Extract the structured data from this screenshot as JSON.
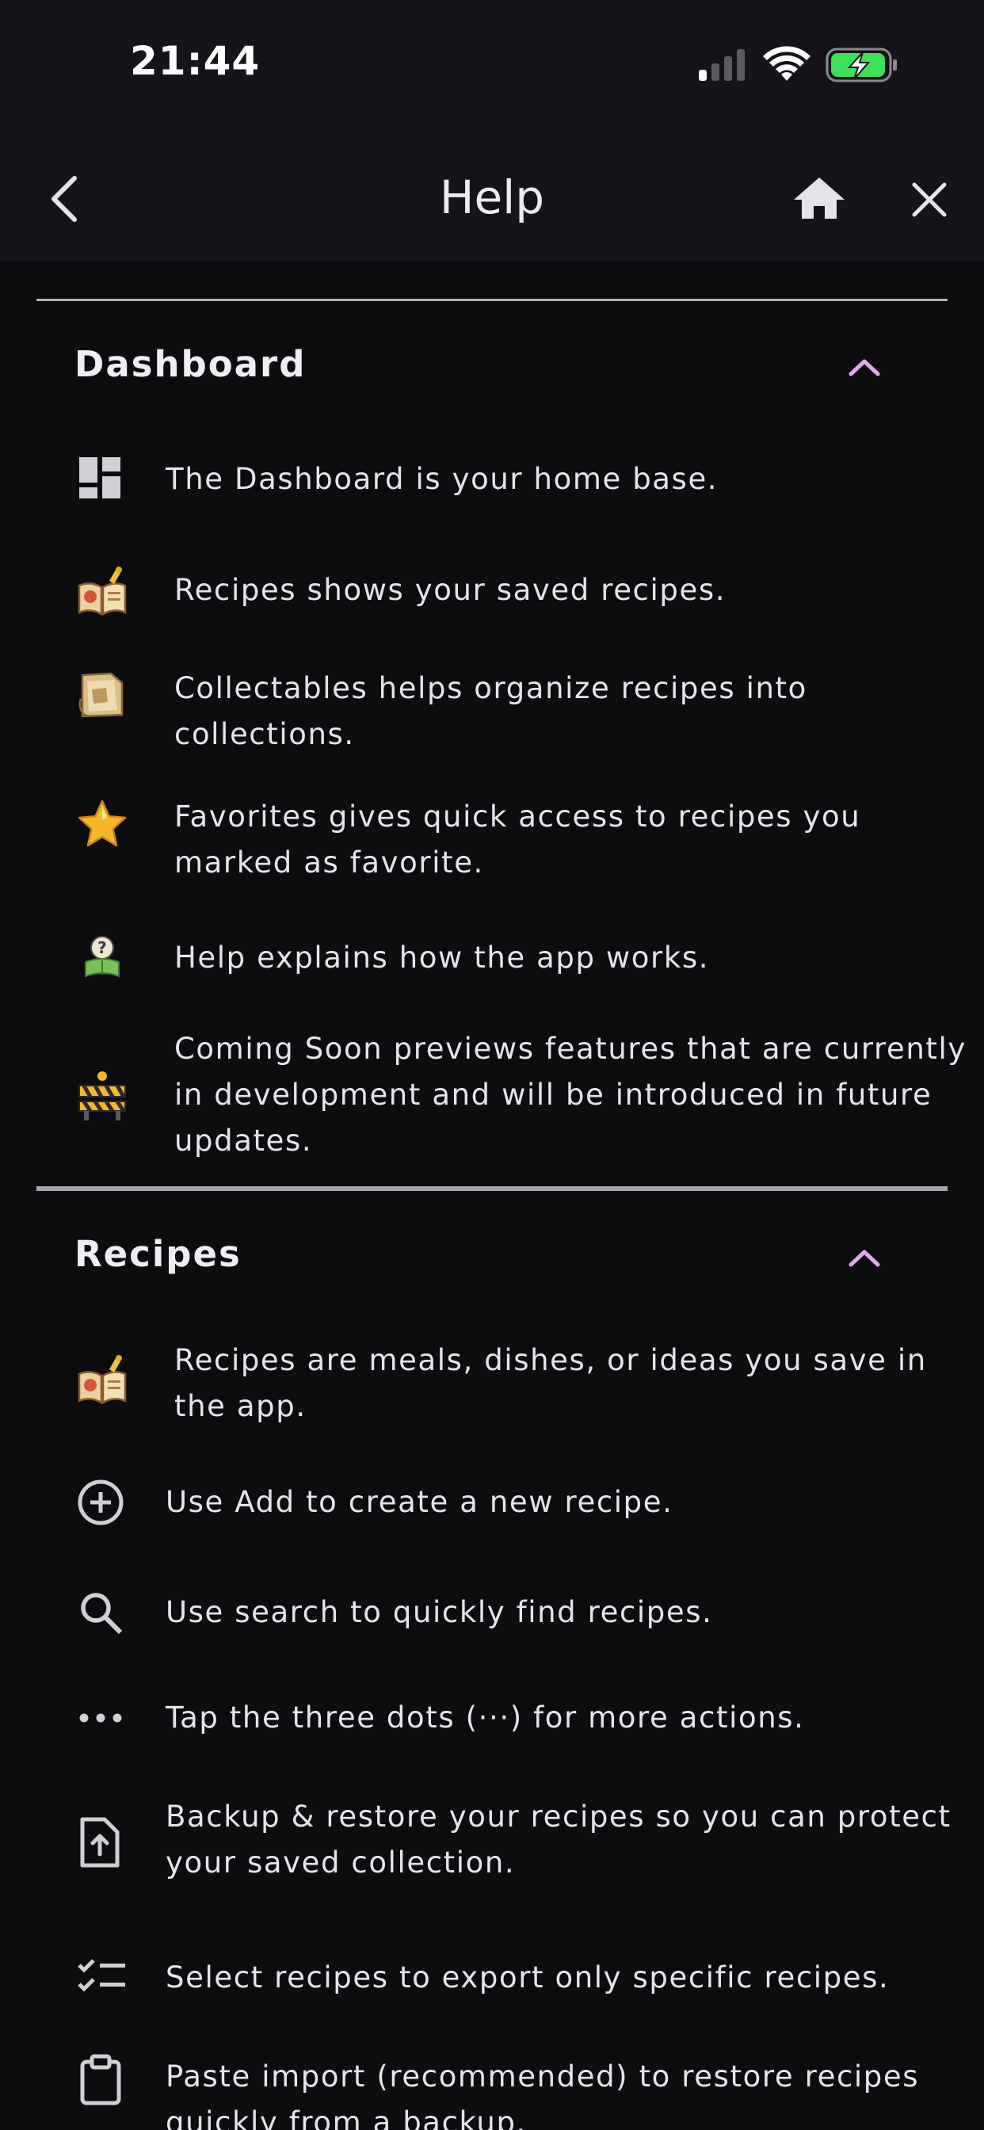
{
  "status_bar": {
    "time": "21:44"
  },
  "app_bar": {
    "title": "Help",
    "back_icon": "chevron-left-icon",
    "home_icon": "home-icon",
    "close_icon": "close-icon"
  },
  "colors": {
    "background": "#0d0d10",
    "app_bar": "#16141a",
    "accent": "#e7a7f3",
    "battery": "#3ee05a"
  },
  "sections": [
    {
      "title": "Dashboard",
      "expanded": true,
      "items": [
        {
          "icon": "dashboard-icon",
          "text": "The Dashboard is your home base."
        },
        {
          "icon": "recipe-book-icon",
          "text": "Recipes shows your saved recipes."
        },
        {
          "icon": "collection-folder-icon",
          "text": "Collectables helps organize recipes into collections."
        },
        {
          "icon": "star-icon",
          "text": "Favorites gives quick access to recipes you marked as favorite."
        },
        {
          "icon": "help-reader-icon",
          "text": "Help explains how the app works."
        },
        {
          "icon": "construction-barrier-icon",
          "text": "Coming Soon previews features that are currently in development and will be introduced in future updates."
        }
      ]
    },
    {
      "title": "Recipes",
      "expanded": true,
      "items": [
        {
          "icon": "recipe-book-icon",
          "text": "Recipes are meals, dishes, or ideas you save in the app."
        },
        {
          "icon": "add-circle-icon",
          "text": "Use Add to create a new recipe."
        },
        {
          "icon": "search-icon",
          "text": "Use search to quickly find recipes."
        },
        {
          "icon": "more-dots-icon",
          "text": "Tap the three dots (···) for more actions."
        },
        {
          "icon": "file-upload-icon",
          "text": "Backup & restore your recipes so you can protect your saved collection."
        },
        {
          "icon": "checklist-icon",
          "text": "Select recipes to export only specific recipes."
        },
        {
          "icon": "clipboard-icon",
          "text": "Paste import (recommended) to restore recipes quickly from a backup."
        }
      ]
    }
  ]
}
